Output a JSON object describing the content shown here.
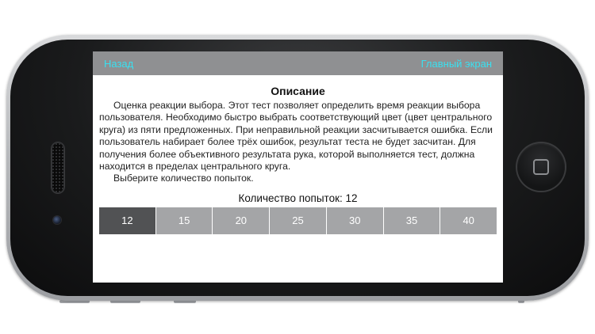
{
  "navbar": {
    "back_label": "Назад",
    "home_label": "Главный экран"
  },
  "description": {
    "title": "Описание",
    "paragraph": "Оценка реакции выбора. Этот тест позволяет определить время реакции выбора пользователя. Необходимо быстро выбрать соответствующий цвет (цвет центрального круга) из пяти предложенных. При неправильной реакции засчитывается ошибка. Если пользователь набирает более трёх ошибок, результат теста не будет засчитан. Для получения более объективного результата рука, которой выполняется тест, должна находится в пределах центрального круга.",
    "instruction": "Выберите количество попыток."
  },
  "attempts": {
    "label": "Количество попыток:",
    "current_value": "12",
    "options": [
      "12",
      "15",
      "20",
      "25",
      "30",
      "35",
      "40"
    ],
    "selected_index": 0
  },
  "colors": {
    "nav_bar": "#8f9092",
    "nav_link": "#39e0f0",
    "segment": "#a4a5a7",
    "segment_selected": "#515254"
  },
  "icons": {
    "home_button": "home-square-icon",
    "speaker": "speaker-grille",
    "camera": "front-camera"
  }
}
